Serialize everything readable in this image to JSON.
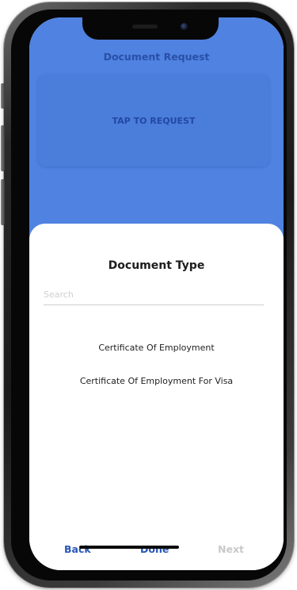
{
  "header": {
    "title": "Document Request"
  },
  "request_card": {
    "label": "TAP TO REQUEST"
  },
  "sheet": {
    "title": "Document Type",
    "search": {
      "placeholder": "Search",
      "value": ""
    },
    "options": [
      {
        "label": "Certificate Of Employment"
      },
      {
        "label": "Certificate Of Employment For Visa"
      }
    ]
  },
  "footer": {
    "back_label": "Back",
    "done_label": "Done",
    "next_label": "Next"
  },
  "colors": {
    "header_blue": "#4f82e1",
    "accent_dark_blue": "#2a57b8",
    "disabled_gray": "#c9c9c9"
  }
}
